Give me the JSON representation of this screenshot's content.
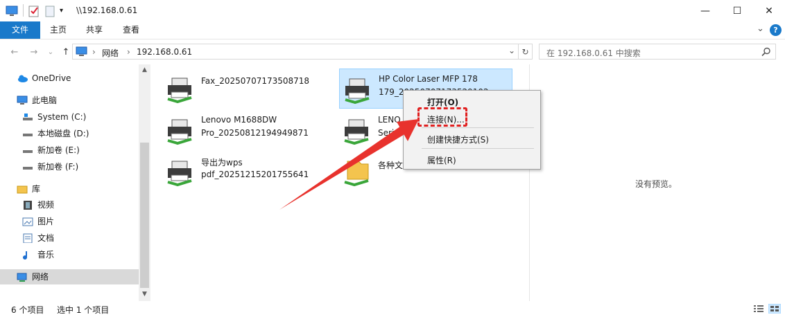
{
  "window": {
    "title": "\\\\192.168.0.61",
    "minimize_glyph": "—",
    "maximize_glyph": "☐",
    "close_glyph": "✕"
  },
  "ribbon": {
    "tabs": [
      "文件",
      "主页",
      "共享",
      "查看"
    ],
    "collapse_glyph": "⌄",
    "help_glyph": "?"
  },
  "address": {
    "path": [
      "网络",
      "192.168.0.61"
    ],
    "separator": "›",
    "dropdown_glyph": "⌄",
    "refresh_glyph": "↻",
    "search_placeholder": "在 192.168.0.61 中搜索"
  },
  "nav": {
    "back_glyph": "←",
    "forward_glyph": "→",
    "recent_glyph": "⌄",
    "up_glyph": "↑",
    "items": [
      {
        "label": "OneDrive",
        "icon": "cloud-icon"
      },
      {
        "label": "此电脑",
        "icon": "computer-icon"
      },
      {
        "label": "System (C:)",
        "icon": "system-drive-icon"
      },
      {
        "label": "本地磁盘 (D:)",
        "icon": "drive-icon"
      },
      {
        "label": "新加卷 (E:)",
        "icon": "drive-icon"
      },
      {
        "label": "新加卷 (F:)",
        "icon": "drive-icon"
      },
      {
        "label": "库",
        "icon": "library-icon"
      },
      {
        "label": "视频",
        "icon": "video-icon"
      },
      {
        "label": "图片",
        "icon": "pictures-icon"
      },
      {
        "label": "文档",
        "icon": "documents-icon"
      },
      {
        "label": "音乐",
        "icon": "music-icon"
      },
      {
        "label": "网络",
        "icon": "network-icon"
      }
    ],
    "selected": "网络"
  },
  "items": [
    {
      "line1": "Fax_20250707173508718",
      "line2": "",
      "icon": "printer-icon"
    },
    {
      "line1": "HP Color Laser MFP 178",
      "line2": "179_20250707173529102",
      "icon": "printer-icon",
      "selected": true
    },
    {
      "line1": "Lenovo M1688DW",
      "line2": "Pro_20250812194949871",
      "icon": "printer-icon"
    },
    {
      "line1": "LENO",
      "line2": "Seri",
      "icon": "printer-icon"
    },
    {
      "line1": "导出为wps",
      "line2": "pdf_20251215201755641",
      "icon": "printer-icon"
    },
    {
      "line1": "各种文",
      "line2": "",
      "icon": "shared-folder-icon"
    }
  ],
  "context_menu": {
    "items": [
      "打开(O)",
      "连接(N)...",
      "创建快捷方式(S)",
      "属性(R)"
    ],
    "highlighted": "连接(N)..."
  },
  "preview": {
    "text": "没有预览。"
  },
  "status": {
    "count": "6 个项目",
    "selected": "选中 1 个项目"
  },
  "colors": {
    "accent": "#1979ca",
    "selection_bg": "#cce8ff",
    "annotation": "#e02020"
  }
}
